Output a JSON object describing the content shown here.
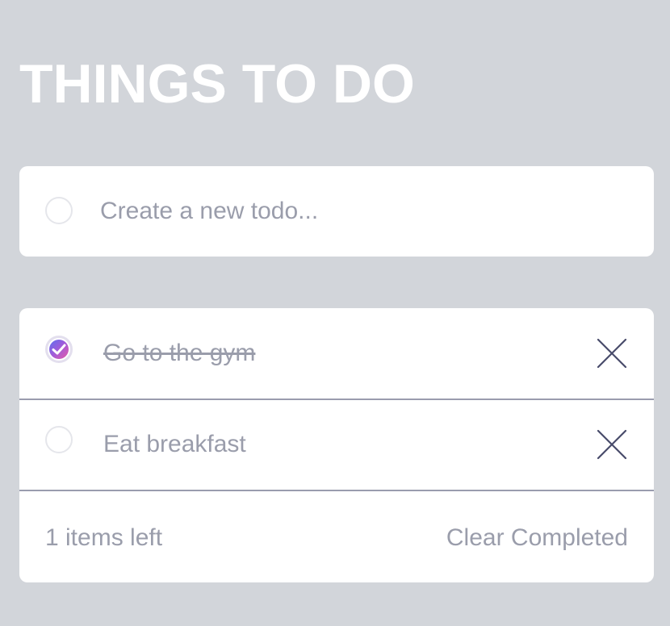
{
  "app": {
    "title": "THINGS TO DO"
  },
  "new_todo": {
    "placeholder": "Create a new todo...",
    "value": ""
  },
  "todos": [
    {
      "text": "Go to the gym",
      "completed": true
    },
    {
      "text": "Eat breakfast",
      "completed": false
    }
  ],
  "footer": {
    "items_left": "1 items left",
    "clear_label": "Clear Completed"
  },
  "icons": {
    "check": "check-icon",
    "delete": "close-icon"
  },
  "colors": {
    "background": "#d2d5da",
    "card": "#ffffff",
    "muted_text": "#9a9dab",
    "check_gradient_start": "#5d6ff0",
    "check_gradient_end": "#e45aa8"
  }
}
